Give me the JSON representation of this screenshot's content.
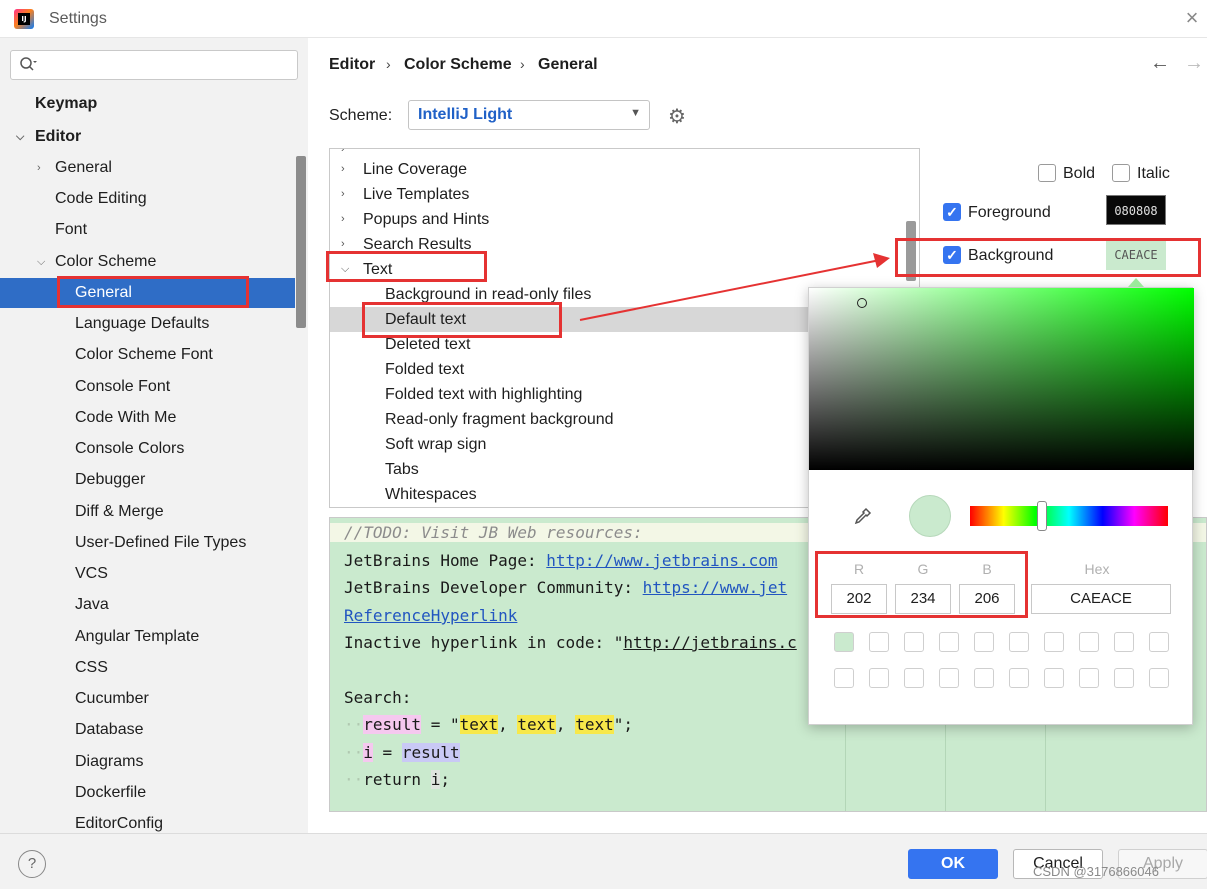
{
  "window": {
    "title": "Settings"
  },
  "search": {
    "placeholder": ""
  },
  "sidebar": {
    "items": [
      {
        "label": "Keymap"
      },
      {
        "label": "Editor"
      },
      {
        "label": "General"
      },
      {
        "label": "Code Editing"
      },
      {
        "label": "Font"
      },
      {
        "label": "Color Scheme"
      },
      {
        "label": "General"
      },
      {
        "label": "Language Defaults"
      },
      {
        "label": "Color Scheme Font"
      },
      {
        "label": "Console Font"
      },
      {
        "label": "Code With Me"
      },
      {
        "label": "Console Colors"
      },
      {
        "label": "Debugger"
      },
      {
        "label": "Diff & Merge"
      },
      {
        "label": "User-Defined File Types"
      },
      {
        "label": "VCS"
      },
      {
        "label": "Java"
      },
      {
        "label": "Angular Template"
      },
      {
        "label": "CSS"
      },
      {
        "label": "Cucumber"
      },
      {
        "label": "Database"
      },
      {
        "label": "Diagrams"
      },
      {
        "label": "Dockerfile"
      },
      {
        "label": "EditorConfig"
      }
    ]
  },
  "breadcrumb": {
    "items": [
      "Editor",
      "Color Scheme",
      "General"
    ]
  },
  "scheme": {
    "label": "Scheme:",
    "value": "IntelliJ Light"
  },
  "attributes": {
    "items": [
      {
        "label": "Line Coverage"
      },
      {
        "label": "Live Templates"
      },
      {
        "label": "Popups and Hints"
      },
      {
        "label": "Search Results"
      },
      {
        "label": "Text"
      },
      {
        "label": "Background in read-only files"
      },
      {
        "label": "Default text"
      },
      {
        "label": "Deleted text"
      },
      {
        "label": "Folded text"
      },
      {
        "label": "Folded text with highlighting"
      },
      {
        "label": "Read-only fragment background"
      },
      {
        "label": "Soft wrap sign"
      },
      {
        "label": "Tabs"
      },
      {
        "label": "Whitespaces"
      }
    ]
  },
  "preview": {
    "todo": "//TODO: Visit JB Web resources:",
    "home_label": "JetBrains Home Page: ",
    "home_link": "http://www.jetbrains.com",
    "community_label": "JetBrains Developer Community: ",
    "community_link": "https://www.jet",
    "ref_link": "ReferenceHyperlink",
    "inactive_label": "Inactive hyperlink in code: \"",
    "inactive_link": "http://jetbrains.c",
    "search_label": "Search:",
    "result": "result",
    "eq": " = \"",
    "text": "text",
    "comma": ", ",
    "end": "\";",
    "i": "i",
    "eq2": " = ",
    "ret": "return ",
    "semi": ";"
  },
  "options": {
    "bold": "Bold",
    "italic": "Italic",
    "foreground": "Foreground",
    "foreground_value": "080808",
    "background": "Background",
    "background_value": "CAEACE"
  },
  "picker": {
    "r_label": "R",
    "g_label": "G",
    "b_label": "B",
    "hex_label": "Hex",
    "r": "202",
    "g": "234",
    "b": "206",
    "hex": "CAEACE"
  },
  "footer": {
    "help": "?",
    "ok": "OK",
    "cancel": "Cancel",
    "apply": "Apply",
    "watermark": "CSDN @3176866046"
  },
  "colors": {
    "accent": "#3574f0",
    "selection": "#2f6dc6",
    "annotation": "#e53232",
    "preview_bg": "#caeace"
  }
}
